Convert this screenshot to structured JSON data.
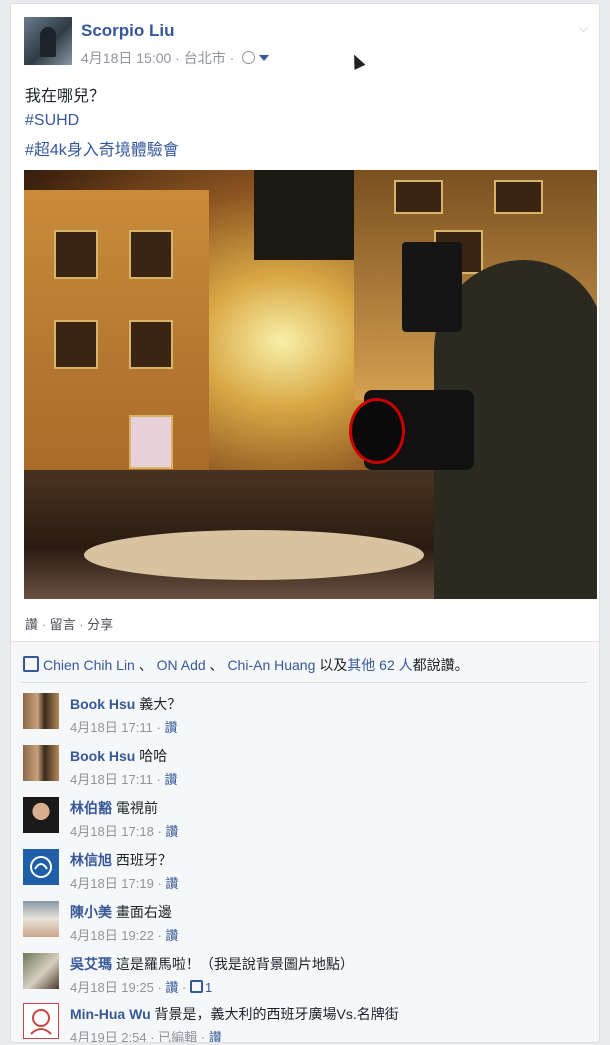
{
  "post": {
    "author": "Scorpio Liu",
    "meta_date": "4月18日 15:00",
    "meta_place": "台北市",
    "meta_sep": " · ",
    "text": "我在哪兒？",
    "tags": [
      "#SUHD",
      "#超4k身入奇境體驗會"
    ],
    "actions": [
      "讚",
      "留言",
      "分享"
    ],
    "chevron": "⌵"
  },
  "likes": {
    "names": [
      "Chien Chih Lin",
      "ON Add",
      "Chi-An Huang"
    ],
    "joiner": " 、 ",
    "tail_prefix": " 以及",
    "others": "其他 62 人",
    "tail_suffix": "都說讚。"
  },
  "comments": [
    {
      "name": "Book Hsu",
      "text": "義大？",
      "time": "4月18日 17:11",
      "like": "讚",
      "edited": "",
      "likes_count": ""
    },
    {
      "name": "Book Hsu",
      "text": "哈哈",
      "time": "4月18日 17:11",
      "like": "讚",
      "edited": "",
      "likes_count": ""
    },
    {
      "name": "林伯豁",
      "text": "電視前",
      "time": "4月18日 17:18",
      "like": "讚",
      "edited": "",
      "likes_count": ""
    },
    {
      "name": "林信旭",
      "text": "西班牙？",
      "time": "4月18日 17:19",
      "like": "讚",
      "edited": "",
      "likes_count": ""
    },
    {
      "name": "陳小美",
      "text": "畫面右邊",
      "time": "4月18日 19:22",
      "like": "讚",
      "edited": "",
      "likes_count": ""
    },
    {
      "name": "吳艾瑪",
      "text": "這是羅馬啦！（我是說背景圖片地點）",
      "time": "4月18日 19:25",
      "like": "讚",
      "edited": "",
      "likes_count": "1"
    },
    {
      "name": "Min-Hua Wu",
      "text": "背景是，義大利的西班牙廣場Vs.名牌街",
      "time": "4月19日 2:54",
      "like": "讚",
      "edited": "已編輯",
      "likes_count": ""
    }
  ],
  "colors": {
    "link": "#365899",
    "meta": "#90949c",
    "bg": "#f6f7f9"
  }
}
